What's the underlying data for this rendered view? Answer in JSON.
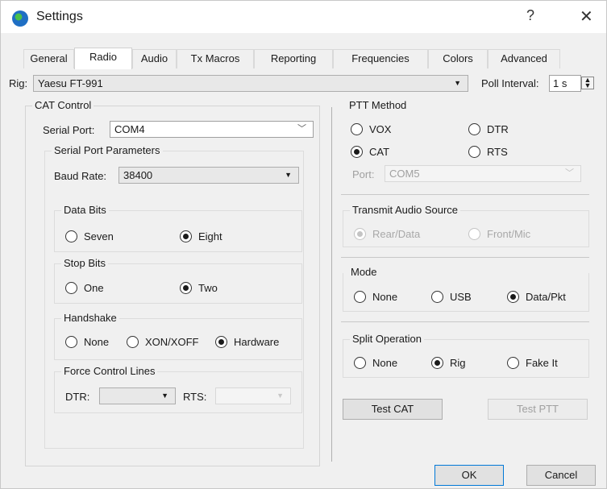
{
  "window": {
    "title": "Settings",
    "help": "?",
    "close": "✕"
  },
  "tabs": [
    {
      "label": "General",
      "active": false
    },
    {
      "label": "Radio",
      "active": true
    },
    {
      "label": "Audio",
      "active": false
    },
    {
      "label": "Tx Macros",
      "active": false
    },
    {
      "label": "Reporting",
      "active": false
    },
    {
      "label": "Frequencies",
      "active": false
    },
    {
      "label": "Colors",
      "active": false
    },
    {
      "label": "Advanced",
      "active": false
    }
  ],
  "rig": {
    "label": "Rig:",
    "value": "Yaesu FT-991",
    "poll_label": "Poll Interval:",
    "poll_value": "1 s"
  },
  "cat": {
    "title": "CAT Control",
    "serial_port_label": "Serial Port:",
    "serial_port_value": "COM4",
    "params_title": "Serial Port Parameters",
    "baud_label": "Baud Rate:",
    "baud_value": "38400",
    "data_bits": {
      "title": "Data Bits",
      "options": [
        "Seven",
        "Eight"
      ],
      "selected": "Eight"
    },
    "stop_bits": {
      "title": "Stop Bits",
      "options": [
        "One",
        "Two"
      ],
      "selected": "Two"
    },
    "handshake": {
      "title": "Handshake",
      "options": [
        "None",
        "XON/XOFF",
        "Hardware"
      ],
      "selected": "Hardware"
    },
    "force": {
      "title": "Force Control Lines",
      "dtr_label": "DTR:",
      "rts_label": "RTS:"
    }
  },
  "ptt": {
    "title": "PTT Method",
    "options": [
      "VOX",
      "DTR",
      "CAT",
      "RTS"
    ],
    "selected": "CAT",
    "port_label": "Port:",
    "port_value": "COM5"
  },
  "tx_audio": {
    "title": "Transmit Audio Source",
    "options": [
      "Rear/Data",
      "Front/Mic"
    ],
    "selected": "Rear/Data"
  },
  "mode": {
    "title": "Mode",
    "options": [
      "None",
      "USB",
      "Data/Pkt"
    ],
    "selected": "Data/Pkt"
  },
  "split": {
    "title": "Split Operation",
    "options": [
      "None",
      "Rig",
      "Fake It"
    ],
    "selected": "Rig"
  },
  "buttons": {
    "test_cat": "Test CAT",
    "test_ptt": "Test PTT",
    "ok": "OK",
    "cancel": "Cancel"
  }
}
